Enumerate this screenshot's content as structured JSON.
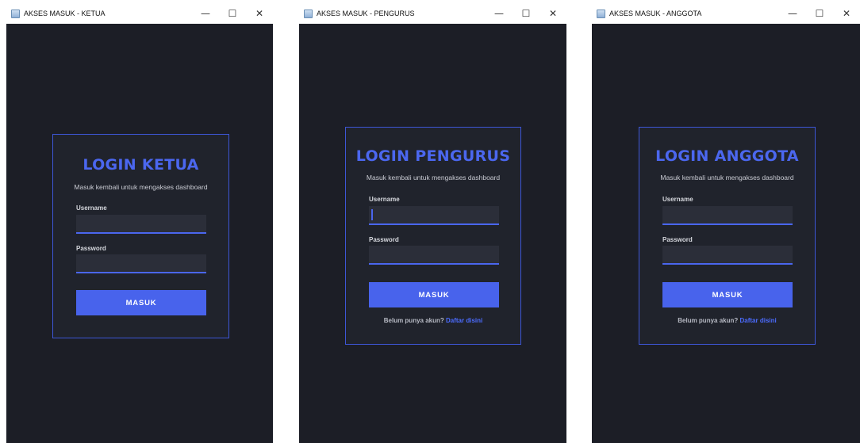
{
  "windows": [
    {
      "title": "AKSES MASUK - KETUA",
      "controls": {
        "minimize": "—",
        "maximize": "☐",
        "close": "✕"
      },
      "card": {
        "title": "LOGIN KETUA",
        "subtitle": "Masuk kembali untuk mengakses dashboard",
        "username_label": "Username",
        "username_value": "",
        "password_label": "Password",
        "password_value": "",
        "button_label": "MASUK"
      }
    },
    {
      "title": "AKSES MASUK - PENGURUS",
      "controls": {
        "minimize": "—",
        "maximize": "☐",
        "close": "✕"
      },
      "card": {
        "title": "LOGIN PENGURUS",
        "subtitle": "Masuk kembali untuk mengakses dashboard",
        "username_label": "Username",
        "username_value": "",
        "password_label": "Password",
        "password_value": "",
        "button_label": "MASUK",
        "footer_text": "Belum punya akun?",
        "footer_link": "Daftar disini"
      }
    },
    {
      "title": "AKSES MASUK - ANGGOTA",
      "controls": {
        "minimize": "—",
        "maximize": "☐",
        "close": "✕"
      },
      "card": {
        "title": "LOGIN ANGGOTA",
        "subtitle": "Masuk kembali untuk mengakses dashboard",
        "username_label": "Username",
        "username_value": "",
        "password_label": "Password",
        "password_value": "",
        "button_label": "MASUK",
        "footer_text": "Belum punya akun?",
        "footer_link": "Daftar disini"
      }
    }
  ],
  "colors": {
    "background": "#1c1e26",
    "card": "#20232c",
    "accent": "#4863ec",
    "input": "#2b2e39"
  }
}
